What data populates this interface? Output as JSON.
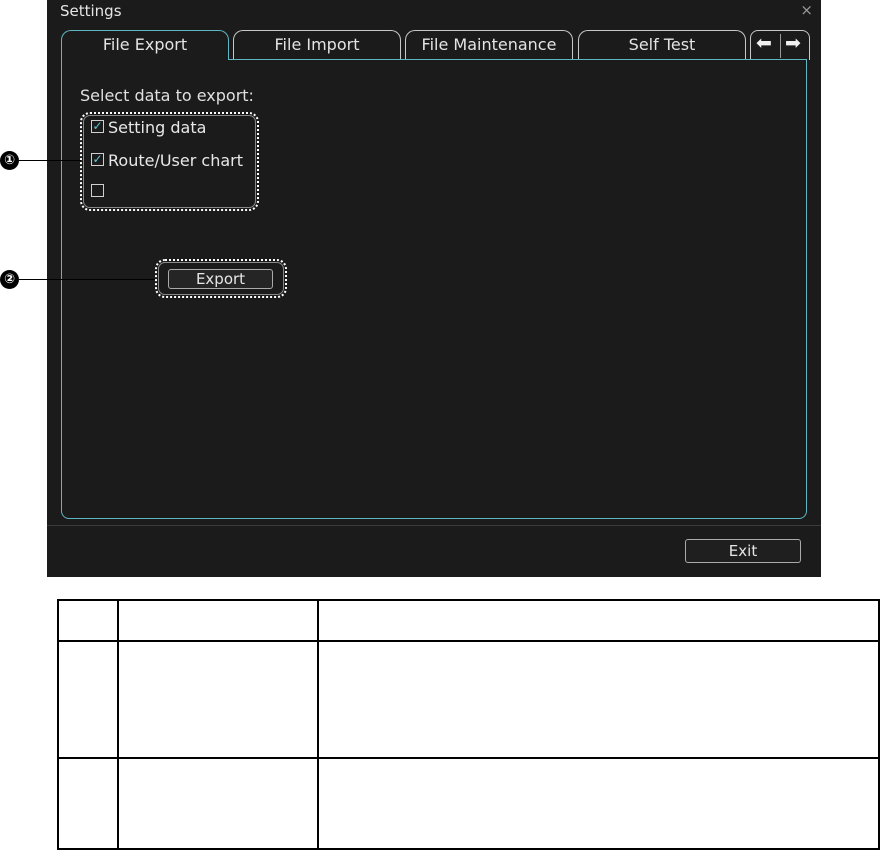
{
  "window": {
    "title": "Settings",
    "close_glyph": "×"
  },
  "tabs": [
    {
      "label": "File Export",
      "active": true
    },
    {
      "label": "File Import",
      "active": false
    },
    {
      "label": "File Maintenance",
      "active": false
    },
    {
      "label": "Self Test",
      "active": false
    }
  ],
  "tab_scroll": {
    "left_glyph": "⬅",
    "right_glyph": "➡"
  },
  "panel": {
    "prompt": "Select data to export:",
    "checkboxes": [
      {
        "label": "Setting data",
        "checked": true,
        "mark": "✓"
      },
      {
        "label": "Route/User chart",
        "checked": true,
        "mark": "✓"
      },
      {
        "label": "",
        "checked": false,
        "mark": ""
      }
    ],
    "export_label": "Export"
  },
  "footer": {
    "exit_label": "Exit"
  },
  "callouts": {
    "one": "①",
    "two": "②"
  },
  "colors": {
    "dialog_bg": "#1b1b1b",
    "accent": "#5fb6c3",
    "text": "#e6e6e6"
  }
}
